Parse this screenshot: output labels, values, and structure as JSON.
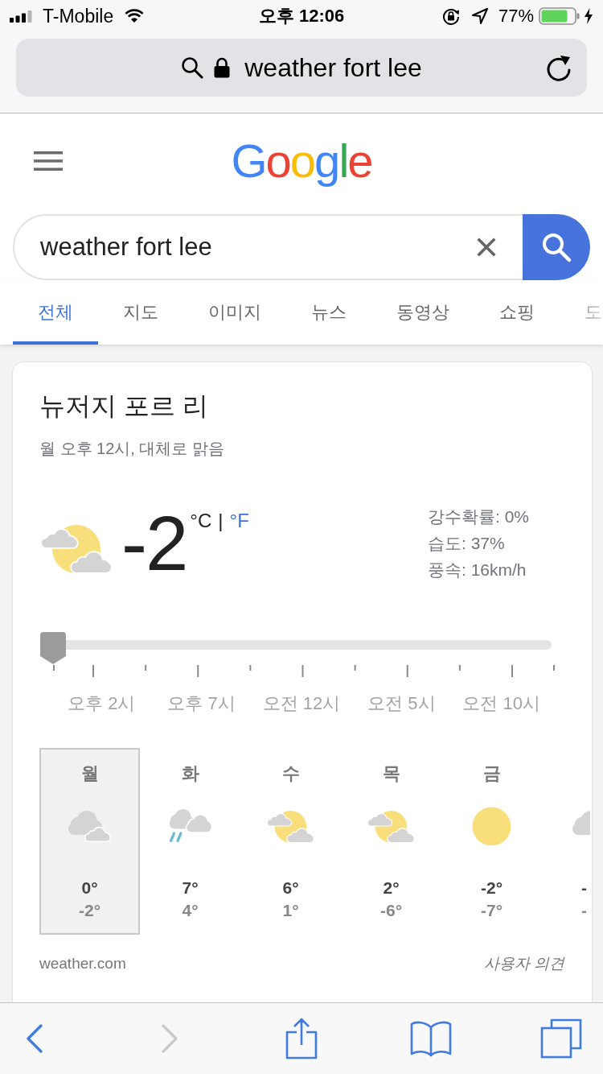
{
  "status_bar": {
    "carrier": "T-Mobile",
    "time": "오후 12:06",
    "battery": "77%"
  },
  "address_bar": {
    "url": "weather fort lee"
  },
  "header": {
    "logo": "Google"
  },
  "search": {
    "value": "weather fort lee"
  },
  "tabs": [
    {
      "label": "전체",
      "selected": true
    },
    {
      "label": "지도",
      "selected": false
    },
    {
      "label": "이미지",
      "selected": false
    },
    {
      "label": "뉴스",
      "selected": false
    },
    {
      "label": "동영상",
      "selected": false
    },
    {
      "label": "쇼핑",
      "selected": false
    },
    {
      "label": "도",
      "selected": false
    }
  ],
  "weather": {
    "location": "뉴저지 포르 리",
    "summary": "월 오후 12시, 대체로 맑음",
    "current": {
      "kind": "partly_sunny",
      "temperature": "-2",
      "units": [
        {
          "label": "°C",
          "selected": true
        },
        {
          "label": "°F",
          "selected": false
        }
      ],
      "unit_separator": "|"
    },
    "details": [
      "강수확률: 0%",
      "습도: 37%",
      "풍속: 16km/h"
    ],
    "timeline": {
      "level": 0,
      "labels": [
        "오후 2시",
        "오후 7시",
        "오전 12시",
        "오전 5시",
        "오전 10시"
      ]
    },
    "days": [
      {
        "day": "월",
        "selected": true,
        "kind": "cloudy",
        "high": "0°",
        "low": "-2°"
      },
      {
        "day": "화",
        "selected": false,
        "kind": "rain",
        "high": "7°",
        "low": "4°"
      },
      {
        "day": "수",
        "selected": false,
        "kind": "partly_sunny",
        "high": "6°",
        "low": "1°"
      },
      {
        "day": "목",
        "selected": false,
        "kind": "partly_sunny",
        "high": "2°",
        "low": "-6°"
      },
      {
        "day": "금",
        "selected": false,
        "kind": "sunny",
        "high": "-2°",
        "low": "-7°"
      },
      {
        "selected": false,
        "kind": "cloudy",
        "high": "-",
        "low": "-"
      }
    ],
    "source": "weather.com",
    "feedback": "사용자 의견"
  },
  "toolbar": {
    "buttons": [
      {
        "kind": "back",
        "disabled": false
      },
      {
        "kind": "forward",
        "disabled": true
      },
      {
        "kind": "share",
        "disabled": false
      },
      {
        "kind": "bookmarks",
        "disabled": false
      },
      {
        "kind": "tabs",
        "disabled": false
      }
    ]
  }
}
